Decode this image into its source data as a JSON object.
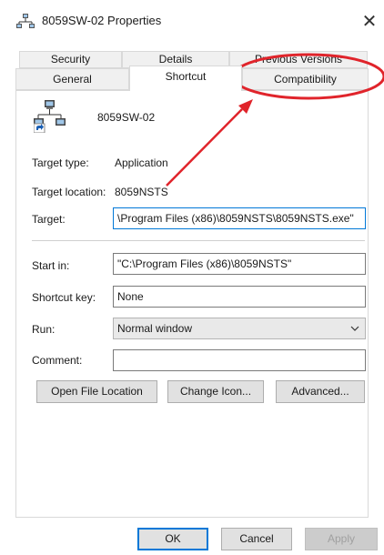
{
  "window": {
    "title": "8059SW-02 Properties",
    "close_symbol": "✕"
  },
  "tabs": {
    "row1": [
      "Security",
      "Details",
      "Previous Versions"
    ],
    "row2": [
      "General",
      "Shortcut",
      "Compatibility"
    ],
    "active": "Shortcut"
  },
  "shortcut": {
    "name": "8059SW-02",
    "target_type_label": "Target type:",
    "target_type_value": "Application",
    "target_location_label": "Target location:",
    "target_location_value": "8059NSTS",
    "target_label": "Target:",
    "target_value": "\\Program Files (x86)\\8059NSTS\\8059NSTS.exe\"",
    "start_in_label": "Start in:",
    "start_in_value": "\"C:\\Program Files (x86)\\8059NSTS\"",
    "shortcut_key_label": "Shortcut key:",
    "shortcut_key_value": "None",
    "run_label": "Run:",
    "run_value": "Normal window",
    "comment_label": "Comment:",
    "comment_value": ""
  },
  "buttons": {
    "open_file_location": "Open File Location",
    "change_icon": "Change Icon...",
    "advanced": "Advanced...",
    "ok": "OK",
    "cancel": "Cancel",
    "apply": "Apply"
  },
  "icons": {
    "window": "network-computers-icon",
    "shortcut": "network-computers-shortcut-icon",
    "dropdown": "chevron-down-icon"
  },
  "colors": {
    "annotation_red": "#e0242b",
    "default_button_border": "#0078d7"
  }
}
